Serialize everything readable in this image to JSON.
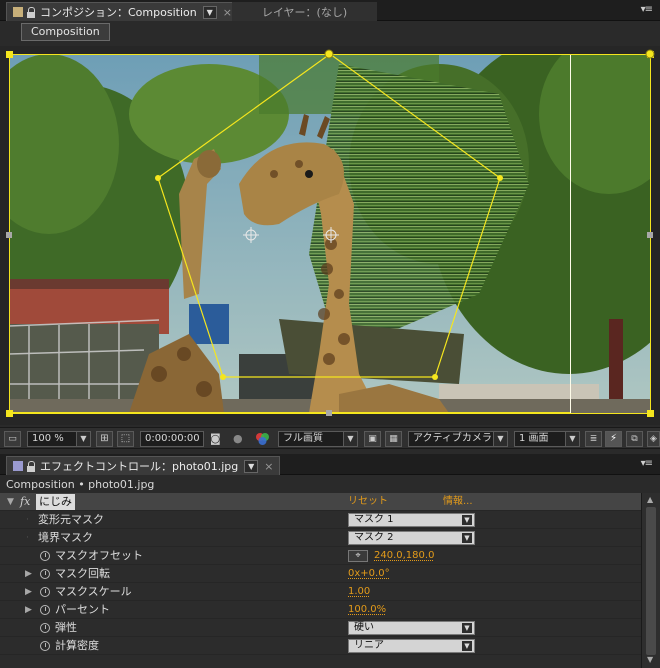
{
  "comp_panel": {
    "tab_title": "コンポジション：Composition",
    "layer_tab": "レイヤー：(なし)",
    "comp_button": "Composition"
  },
  "viewer_toolbar": {
    "zoom": "100 %",
    "timecode": "0:00:00:00",
    "resolution": "フル画質",
    "camera": "アクティブカメラ",
    "view_layout": "1 画面"
  },
  "effects_panel": {
    "tab_title": "エフェクトコントロール：photo01.jpg",
    "header": "Composition • photo01.jpg",
    "effect": {
      "fx": "fx",
      "name": "にじみ",
      "reset": "リセット",
      "about": "情報..."
    },
    "properties": [
      {
        "label": "変形元マスク",
        "type": "dropdown",
        "value": "マスク 1"
      },
      {
        "label": "境界マスク",
        "type": "dropdown",
        "value": "マスク 2"
      },
      {
        "label": "マスクオフセット",
        "type": "point",
        "value": "240.0,180.0"
      },
      {
        "label": "マスク回転",
        "type": "value",
        "value": "0x+0.0°"
      },
      {
        "label": "マスクスケール",
        "type": "value",
        "value": "1.00"
      },
      {
        "label": "パーセント",
        "type": "value",
        "value": "100.0%"
      },
      {
        "label": "弾性",
        "type": "dropdown",
        "value": "硬い"
      },
      {
        "label": "計算密度",
        "type": "dropdown",
        "value": "リニア"
      }
    ]
  },
  "colors": {
    "accent_orange": "#e39b1a",
    "mask_yellow": "#f5e61e",
    "panel_bg": "#2a2a2a"
  },
  "icons": [
    "comp-icon",
    "lock-icon",
    "menu-icon",
    "stopwatch-icon",
    "anchor-icon",
    "snapshot-icon",
    "grid-icon",
    "channel-icon",
    "camera-icon",
    "fx-icon"
  ]
}
